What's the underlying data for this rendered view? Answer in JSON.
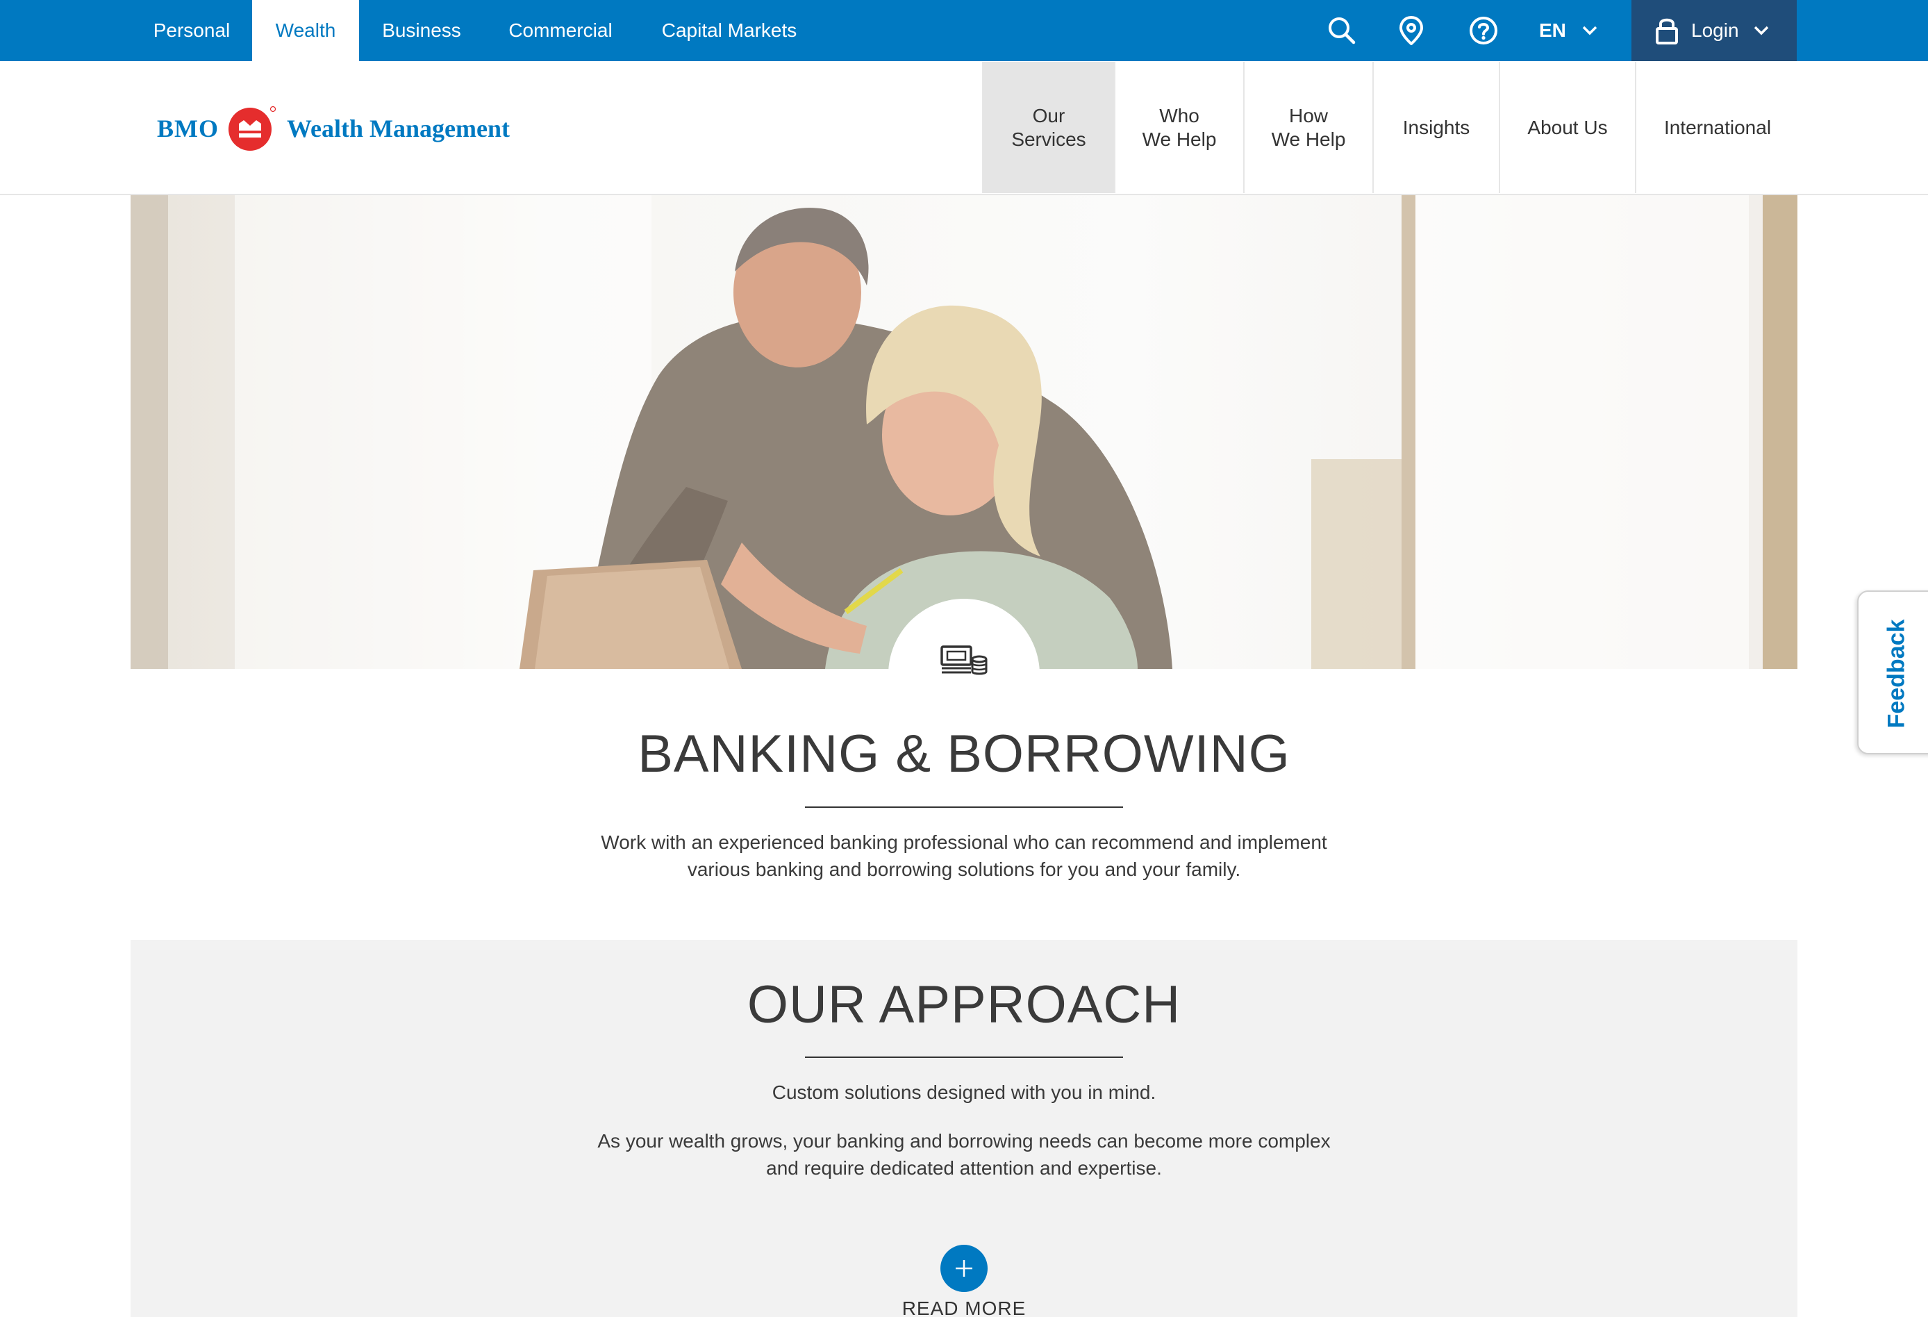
{
  "colors": {
    "brand_blue": "#0079c1",
    "login_bg": "#1f4d7a",
    "brand_red": "#e52d2d",
    "section_gray": "#f2f2f2"
  },
  "topbar": {
    "segments": [
      "Personal",
      "Wealth",
      "Business",
      "Commercial",
      "Capital Markets"
    ],
    "active_segment": "Wealth",
    "icons": [
      "search-icon",
      "location-icon",
      "help-icon"
    ],
    "language": "EN",
    "login_label": "Login"
  },
  "header": {
    "logo": {
      "bmo": "BMO",
      "wordmark": "Wealth Management",
      "registered": "®"
    },
    "nav": [
      {
        "label": "Our\nServices",
        "active": true
      },
      {
        "label": "Who\nWe Help",
        "active": false
      },
      {
        "label": "How\nWe Help",
        "active": false
      },
      {
        "label": "Insights",
        "active": false
      },
      {
        "label": "About Us",
        "active": false
      },
      {
        "label": "International",
        "active": false
      }
    ]
  },
  "hero": {
    "icon": "money-coins-icon"
  },
  "banking": {
    "title": "BANKING & BORROWING",
    "description_line1": "Work with an experienced banking professional who can recommend and implement",
    "description_line2": "various banking and borrowing solutions for you and your family."
  },
  "approach": {
    "title": "OUR APPROACH",
    "tagline": "Custom solutions designed with you in mind.",
    "body_line1": "As your wealth grows, your banking and borrowing needs can become more complex",
    "body_line2": "and require dedicated attention and expertise.",
    "read_more": "READ MORE"
  },
  "feedback": {
    "label": "Feedback"
  }
}
